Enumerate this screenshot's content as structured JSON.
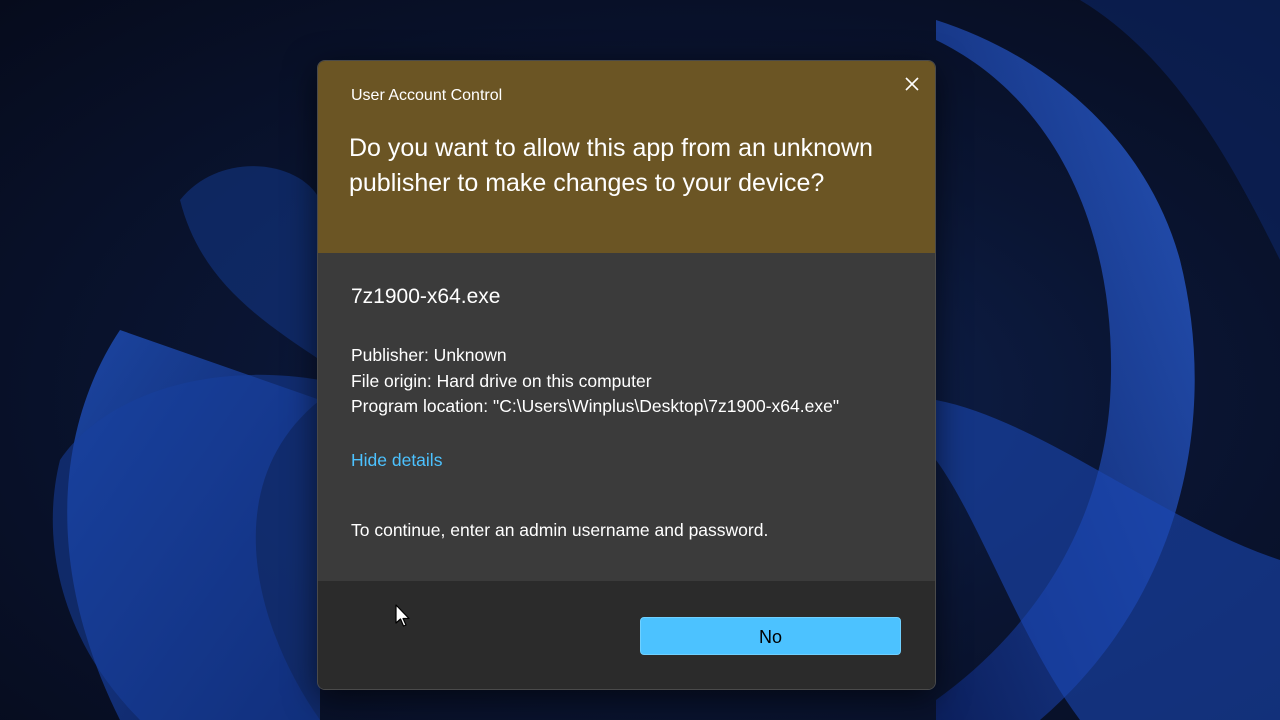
{
  "dialog": {
    "window_title": "User Account Control",
    "question": "Do you want to allow this app from an unknown publisher to make changes to your device?",
    "program_name": "7z1900-x64.exe",
    "details": {
      "publisher": "Publisher: Unknown",
      "file_origin": "File origin: Hard drive on this computer",
      "program_location": "Program location: \"C:\\Users\\Winplus\\Desktop\\7z1900-x64.exe\""
    },
    "hide_details_label": "Hide details",
    "instruction": "To continue, enter an admin username and password.",
    "no_button_label": "No",
    "close_icon": "close-icon"
  },
  "colors": {
    "header_bg": "#6b5524",
    "body_bg": "#3b3b3b",
    "footer_bg": "#2b2b2b",
    "accent": "#4cc2ff"
  }
}
